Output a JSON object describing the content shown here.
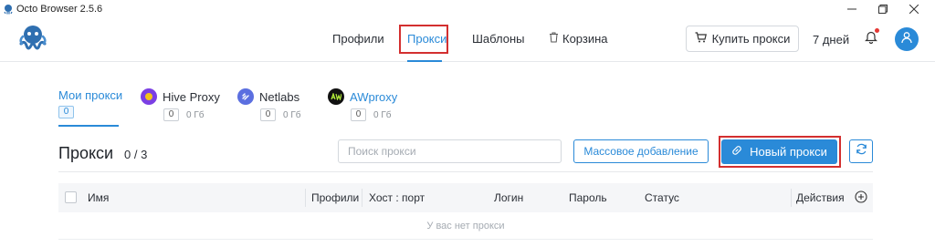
{
  "window": {
    "title": "Octo Browser 2.5.6",
    "controls": [
      "minimize-icon",
      "maximize-icon",
      "close-icon"
    ]
  },
  "header": {
    "logo": "octopus-logo",
    "nav": {
      "profiles": "Профили",
      "proxies": "Прокси",
      "templates": "Шаблоны",
      "trash": "Корзина"
    },
    "active_nav": "proxies",
    "buy_proxy_label": "Купить прокси",
    "days_left": "7 дней",
    "notification_badge": true,
    "accent_color": "#2a8ad8",
    "highlight_color": "#d32f2f"
  },
  "provider_tabs": [
    {
      "label": "Мои прокси",
      "count": "0",
      "active": true
    },
    {
      "label": "Hive Proxy",
      "count": "0",
      "traffic": "0 Гб",
      "icon": "hive-proxy-icon"
    },
    {
      "label": "Netlabs",
      "count": "0",
      "traffic": "0 Гб",
      "icon": "netlabs-icon"
    },
    {
      "label": "AWproxy",
      "count": "0",
      "traffic": "0 Гб",
      "icon": "awproxy-icon"
    }
  ],
  "section": {
    "title": "Прокси",
    "count": "0 / 3",
    "search_placeholder": "Поиск прокси",
    "bulk_add_label": "Массовое добавление",
    "new_proxy_label": "Новый прокси"
  },
  "table": {
    "columns": [
      "Имя",
      "Профили",
      "Хост : порт",
      "Логин",
      "Пароль",
      "Статус",
      "Действия"
    ],
    "empty_text": "У вас нет прокси"
  }
}
